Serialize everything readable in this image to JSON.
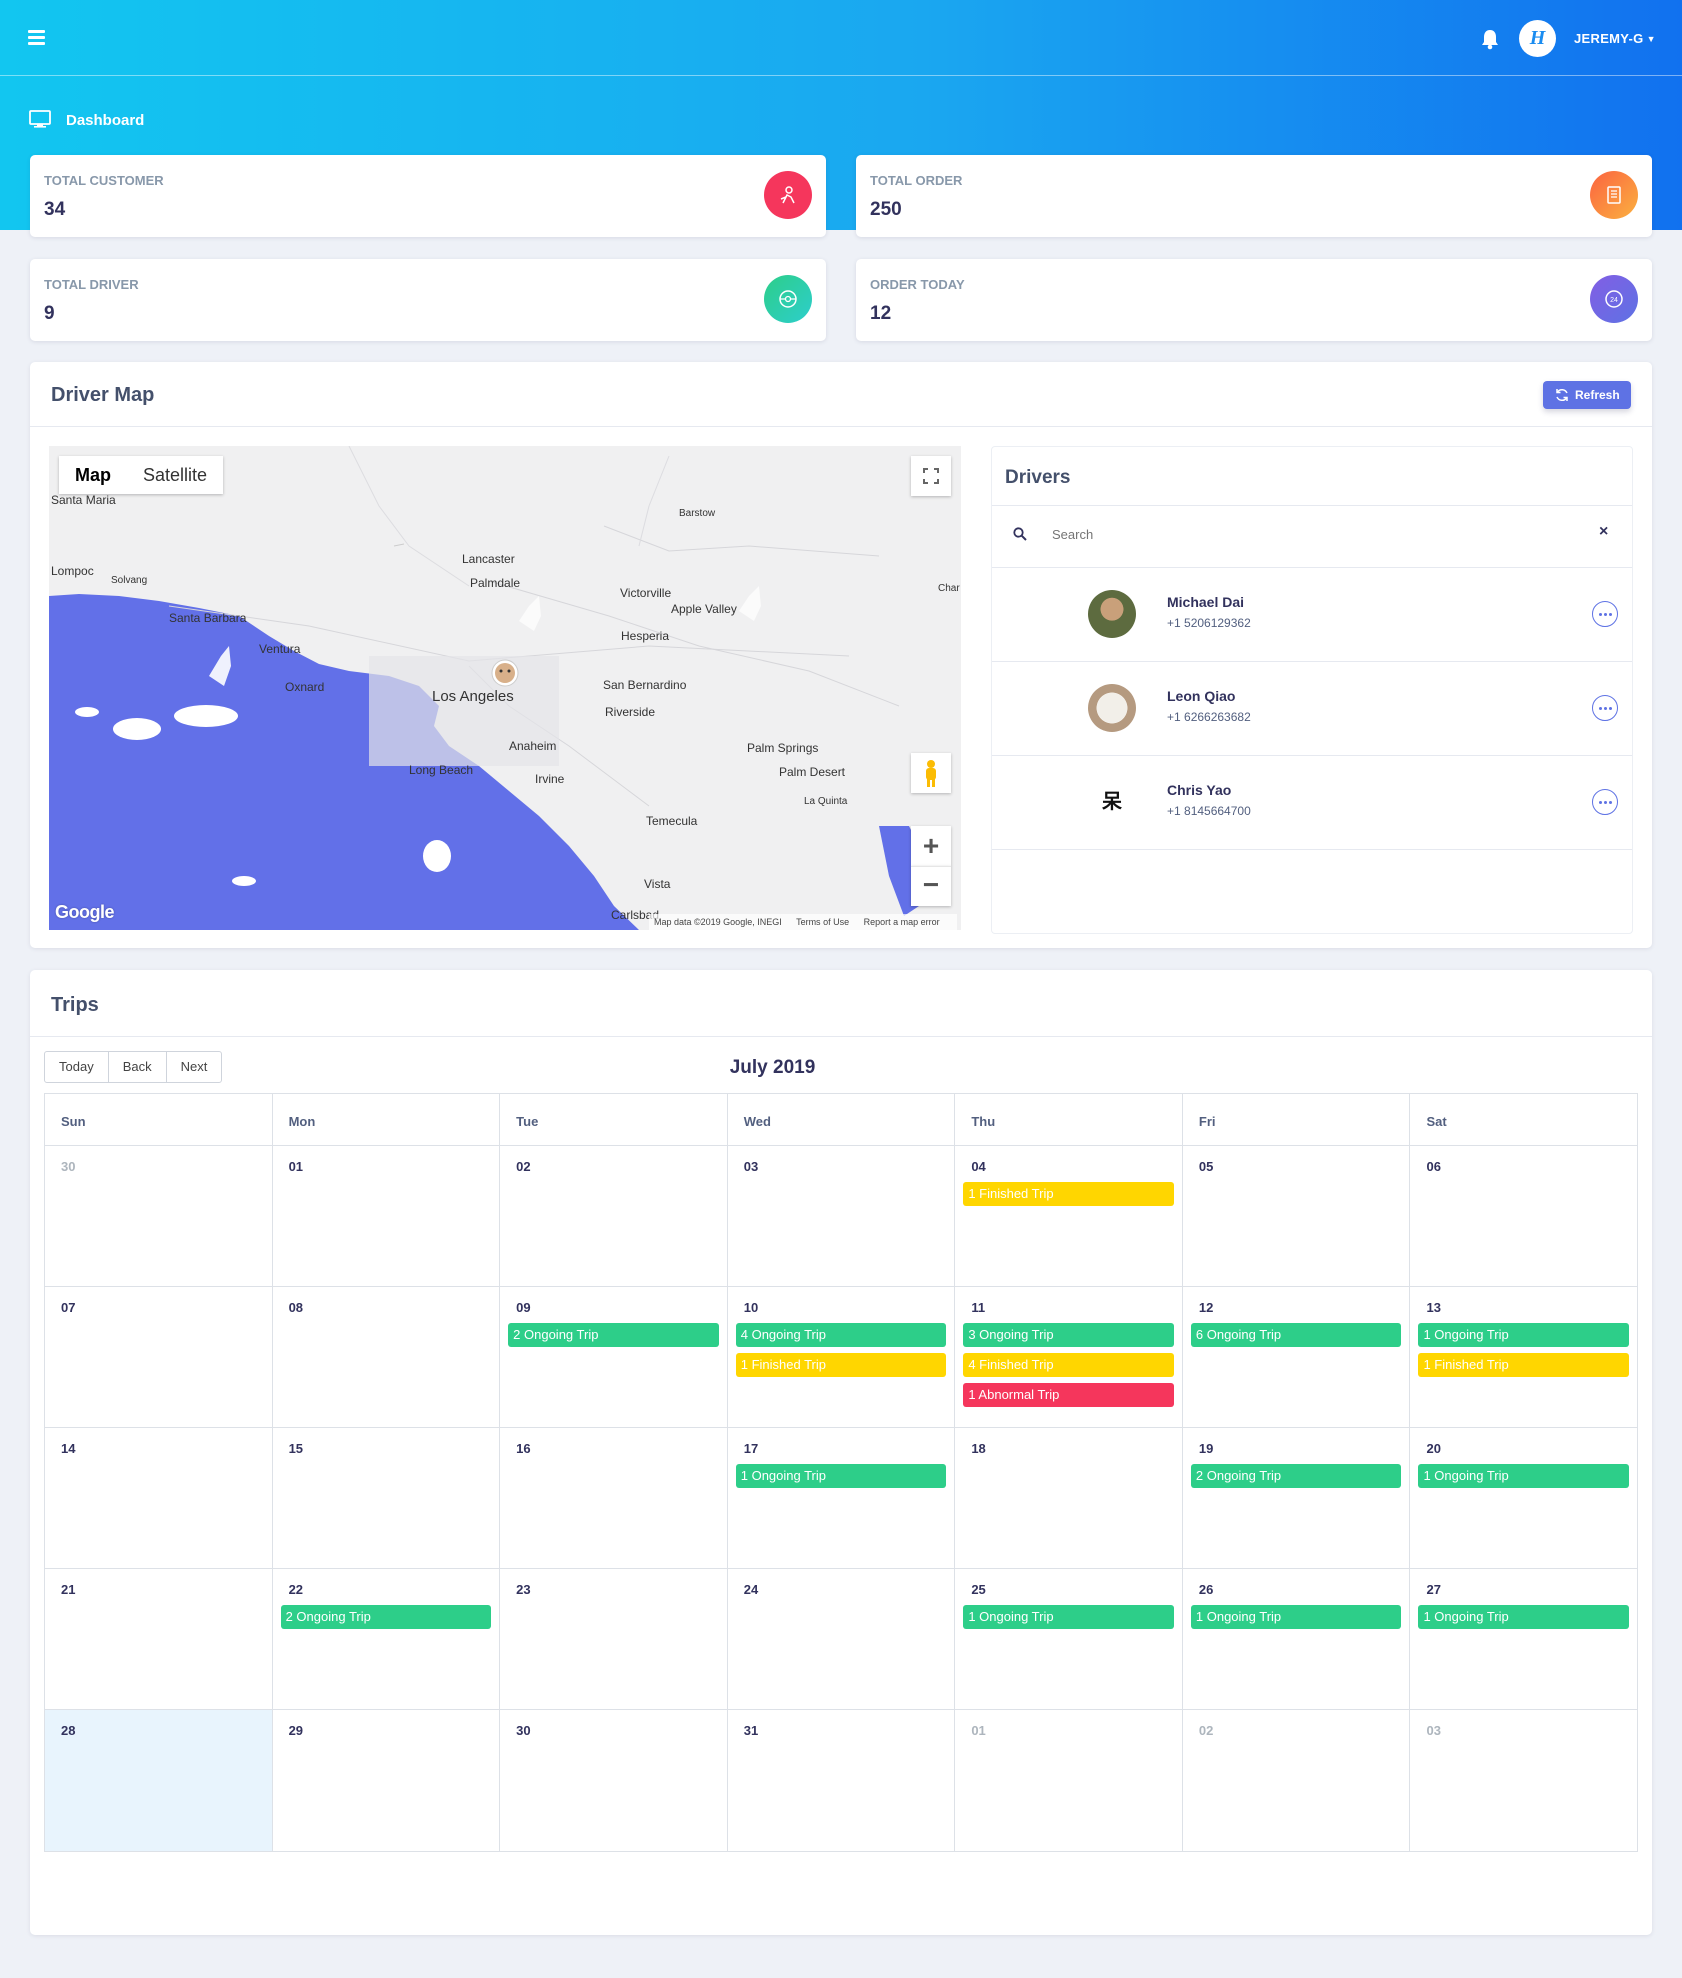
{
  "topbar": {
    "user": "JEREMY-G",
    "logo_text": "H"
  },
  "breadcrumb": {
    "label": "Dashboard"
  },
  "stats": [
    {
      "label": "TOTAL CUSTOMER",
      "value": "34",
      "icon": "customer-icon",
      "color": "#f5365c"
    },
    {
      "label": "TOTAL ORDER",
      "value": "250",
      "icon": "order-icon",
      "color": "#fb6340"
    },
    {
      "label": "TOTAL DRIVER",
      "value": "9",
      "icon": "driver-icon",
      "color": "#2dce89"
    },
    {
      "label": "ORDER TODAY",
      "value": "12",
      "icon": "today-icon",
      "color": "#5e72e4"
    }
  ],
  "driver_map": {
    "title": "Driver Map",
    "refresh_label": "Refresh",
    "map_type": [
      "Map",
      "Satellite"
    ],
    "places": [
      "Santa Maria",
      "Lompoc",
      "Solvang",
      "Santa Barbara",
      "Ventura",
      "Oxnard",
      "Lancaster",
      "Palmdale",
      "Victorville",
      "Apple Valley",
      "Hesperia",
      "Barstow",
      "Los Angeles",
      "San Bernardino",
      "Riverside",
      "Anaheim",
      "Long Beach",
      "Irvine",
      "Palm Springs",
      "Palm Desert",
      "La Quinta",
      "Temecula",
      "Vista",
      "Carlsbad",
      "Char"
    ],
    "google_logo": "Google",
    "attribution": [
      "Map data ©2019 Google, INEGI",
      "Terms of Use",
      "Report a map error"
    ]
  },
  "drivers": {
    "title": "Drivers",
    "search_placeholder": "Search",
    "list": [
      {
        "name": "Michael Dai",
        "phone": "+1 5206129362"
      },
      {
        "name": "Leon Qiao",
        "phone": "+1 6266263682"
      },
      {
        "name": "Chris Yao",
        "phone": "+1 8145664700",
        "avatar_text": "呆"
      }
    ]
  },
  "trips": {
    "title": "Trips",
    "nav": [
      "Today",
      "Back",
      "Next"
    ],
    "month": "July 2019",
    "weekdays": [
      "Sun",
      "Mon",
      "Tue",
      "Wed",
      "Thu",
      "Fri",
      "Sat"
    ],
    "weeks": [
      [
        {
          "d": "30",
          "off": true
        },
        {
          "d": "01"
        },
        {
          "d": "02"
        },
        {
          "d": "03"
        },
        {
          "d": "04",
          "events": [
            {
              "t": "1 Finished Trip",
              "k": "finished"
            }
          ]
        },
        {
          "d": "05"
        },
        {
          "d": "06"
        }
      ],
      [
        {
          "d": "07"
        },
        {
          "d": "08"
        },
        {
          "d": "09",
          "events": [
            {
              "t": "2 Ongoing Trip",
              "k": "ongoing"
            }
          ]
        },
        {
          "d": "10",
          "events": [
            {
              "t": "4 Ongoing Trip",
              "k": "ongoing"
            },
            {
              "t": "1 Finished Trip",
              "k": "finished"
            }
          ]
        },
        {
          "d": "11",
          "events": [
            {
              "t": "3 Ongoing Trip",
              "k": "ongoing"
            },
            {
              "t": "4 Finished Trip",
              "k": "finished"
            },
            {
              "t": "1 Abnormal Trip",
              "k": "abnormal"
            }
          ]
        },
        {
          "d": "12",
          "events": [
            {
              "t": "6 Ongoing Trip",
              "k": "ongoing"
            }
          ]
        },
        {
          "d": "13",
          "events": [
            {
              "t": "1 Ongoing Trip",
              "k": "ongoing"
            },
            {
              "t": "1 Finished Trip",
              "k": "finished"
            }
          ]
        }
      ],
      [
        {
          "d": "14"
        },
        {
          "d": "15"
        },
        {
          "d": "16"
        },
        {
          "d": "17",
          "events": [
            {
              "t": "1 Ongoing Trip",
              "k": "ongoing"
            }
          ]
        },
        {
          "d": "18"
        },
        {
          "d": "19",
          "events": [
            {
              "t": "2 Ongoing Trip",
              "k": "ongoing"
            }
          ]
        },
        {
          "d": "20",
          "events": [
            {
              "t": "1 Ongoing Trip",
              "k": "ongoing"
            }
          ]
        }
      ],
      [
        {
          "d": "21"
        },
        {
          "d": "22",
          "events": [
            {
              "t": "2 Ongoing Trip",
              "k": "ongoing"
            }
          ]
        },
        {
          "d": "23"
        },
        {
          "d": "24"
        },
        {
          "d": "25",
          "events": [
            {
              "t": "1 Ongoing Trip",
              "k": "ongoing"
            }
          ]
        },
        {
          "d": "26",
          "events": [
            {
              "t": "1 Ongoing Trip",
              "k": "ongoing"
            }
          ]
        },
        {
          "d": "27",
          "events": [
            {
              "t": "1 Ongoing Trip",
              "k": "ongoing"
            }
          ]
        }
      ],
      [
        {
          "d": "28",
          "today": true
        },
        {
          "d": "29"
        },
        {
          "d": "30"
        },
        {
          "d": "31"
        },
        {
          "d": "01",
          "off": true
        },
        {
          "d": "02",
          "off": true
        },
        {
          "d": "03",
          "off": true
        }
      ]
    ]
  },
  "colors": {
    "primary": "#5e72e4",
    "ongoing": "#2dce89",
    "finished": "#ffd600",
    "abnormal": "#f5365c",
    "water": "#6270e8"
  }
}
